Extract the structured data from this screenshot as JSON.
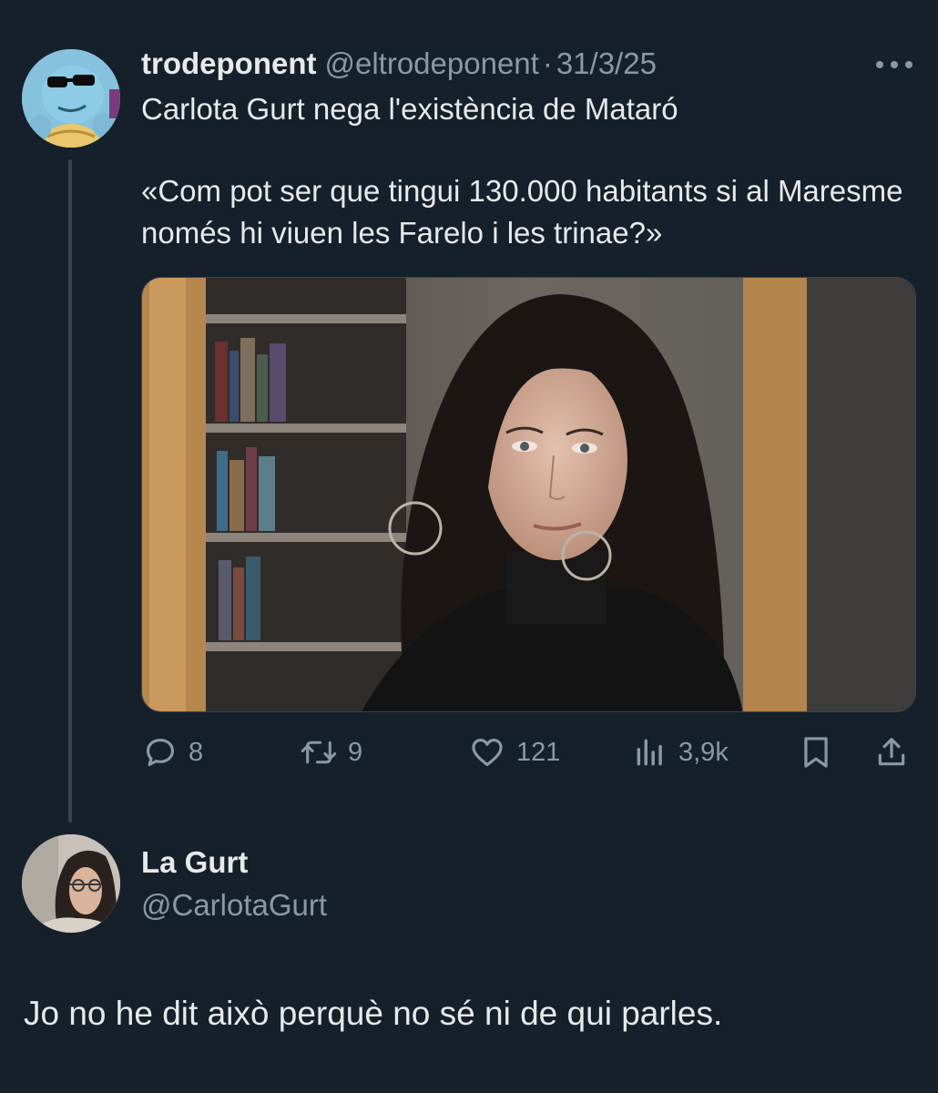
{
  "tweet": {
    "author": {
      "display_name": "trodeponent",
      "handle": "@eltrodeponent",
      "avatar_icon": "squirtle-sunglasses-avatar"
    },
    "separator": "·",
    "date": "31/3/25",
    "text_line1": "Carlota Gurt nega l'existència de Mataró",
    "text_quote": "«Com pot ser que tingui 130.000 habitants si al Maresme només hi viuen les Farelo i les trinae?»",
    "media_icon": "portrait-photo-woman-bookshelf",
    "actions": {
      "replies": "8",
      "retweets": "9",
      "likes": "121",
      "views": "3,9k"
    }
  },
  "reply": {
    "author": {
      "display_name": "La Gurt",
      "handle": "@CarlotaGurt",
      "avatar_icon": "woman-glasses-avatar"
    },
    "text": "Jo no he dit això perquè no sé ni de qui parles."
  },
  "colors": {
    "background": "#15202b",
    "text": "#e7e9ea",
    "muted": "#8b98a5",
    "border": "#38444d"
  }
}
